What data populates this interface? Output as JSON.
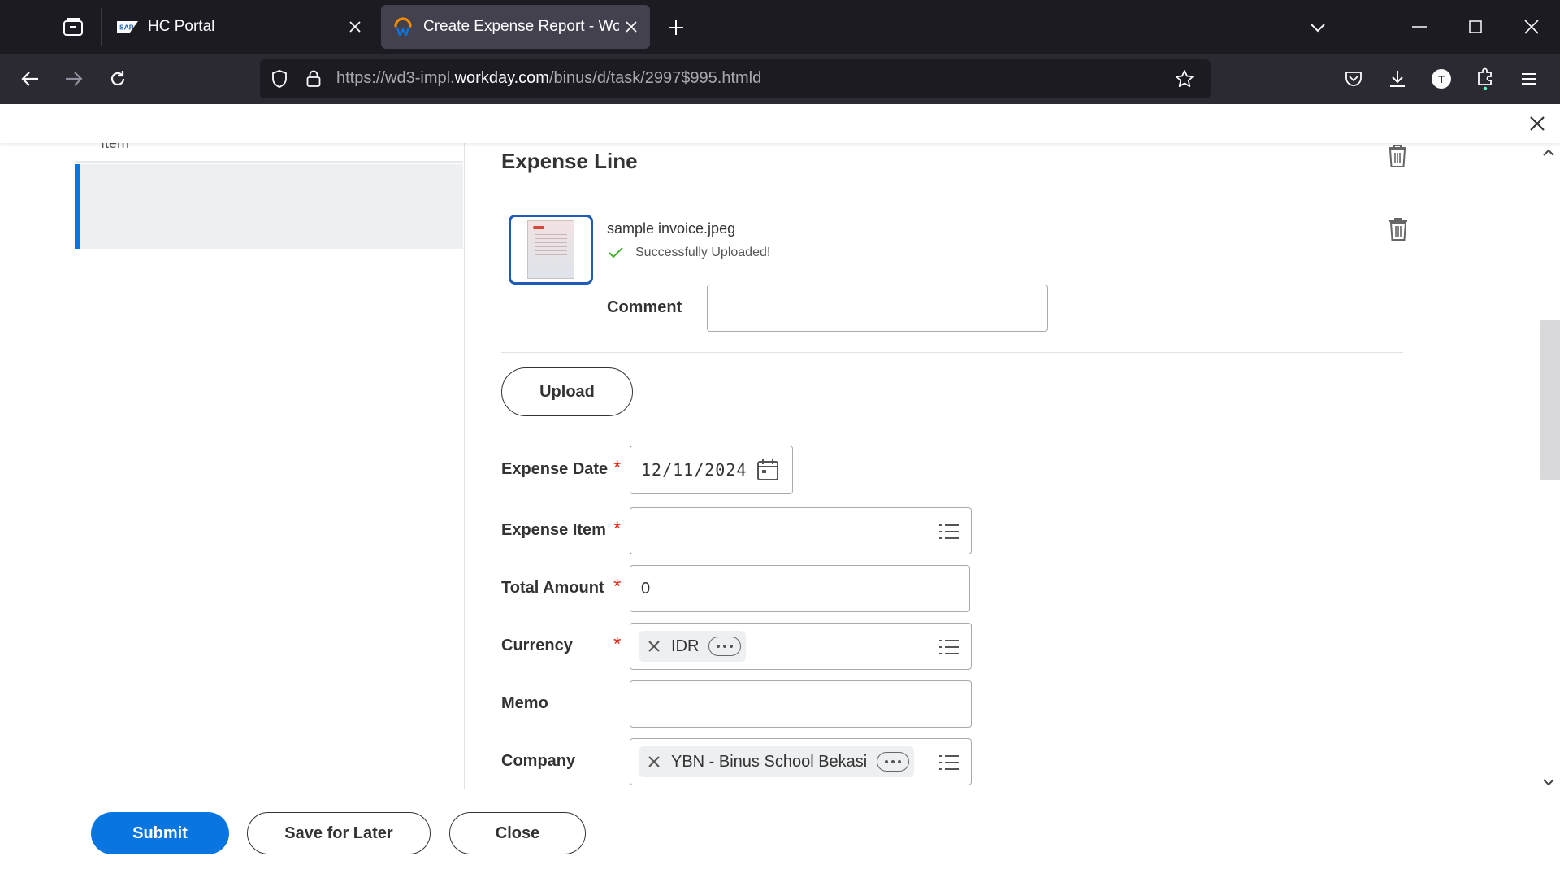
{
  "browser": {
    "tabs": [
      {
        "title": "HC Portal",
        "favicon": "sap-logo",
        "logo_text": "SAP",
        "active": false
      },
      {
        "title": "Create Expense Report - Workday",
        "favicon": "workday-logo",
        "active": true
      }
    ],
    "url": {
      "prefix": "https://wd3-impl.",
      "domain": "workday.com",
      "path": "/binus/d/task/2997$995.htmld"
    },
    "profile_initial": "T"
  },
  "left_panel": {
    "partial_item": "Item"
  },
  "expense_line": {
    "title": "Expense Line",
    "attachment": {
      "filename": "sample invoice.jpeg",
      "status": "Successfully Uploaded!"
    },
    "comment": {
      "label": "Comment",
      "value": ""
    },
    "upload_label": "Upload",
    "fields": {
      "expense_date": {
        "label": "Expense Date",
        "required_mark": "*",
        "value": "12/11/2024"
      },
      "expense_item": {
        "label": "Expense Item",
        "required_mark": "*",
        "value": ""
      },
      "total_amount": {
        "label": "Total Amount",
        "required_mark": "*",
        "value": "0"
      },
      "currency": {
        "label": "Currency",
        "required_mark": "*",
        "value": "IDR"
      },
      "memo": {
        "label": "Memo",
        "value": ""
      },
      "company": {
        "label": "Company",
        "value": "YBN - Binus School Bekasi"
      }
    }
  },
  "footer": {
    "submit": "Submit",
    "save_for_later": "Save for Later",
    "close": "Close"
  },
  "colors": {
    "primary": "#0875e1",
    "required": "#de2e21",
    "success": "#43b02a"
  }
}
